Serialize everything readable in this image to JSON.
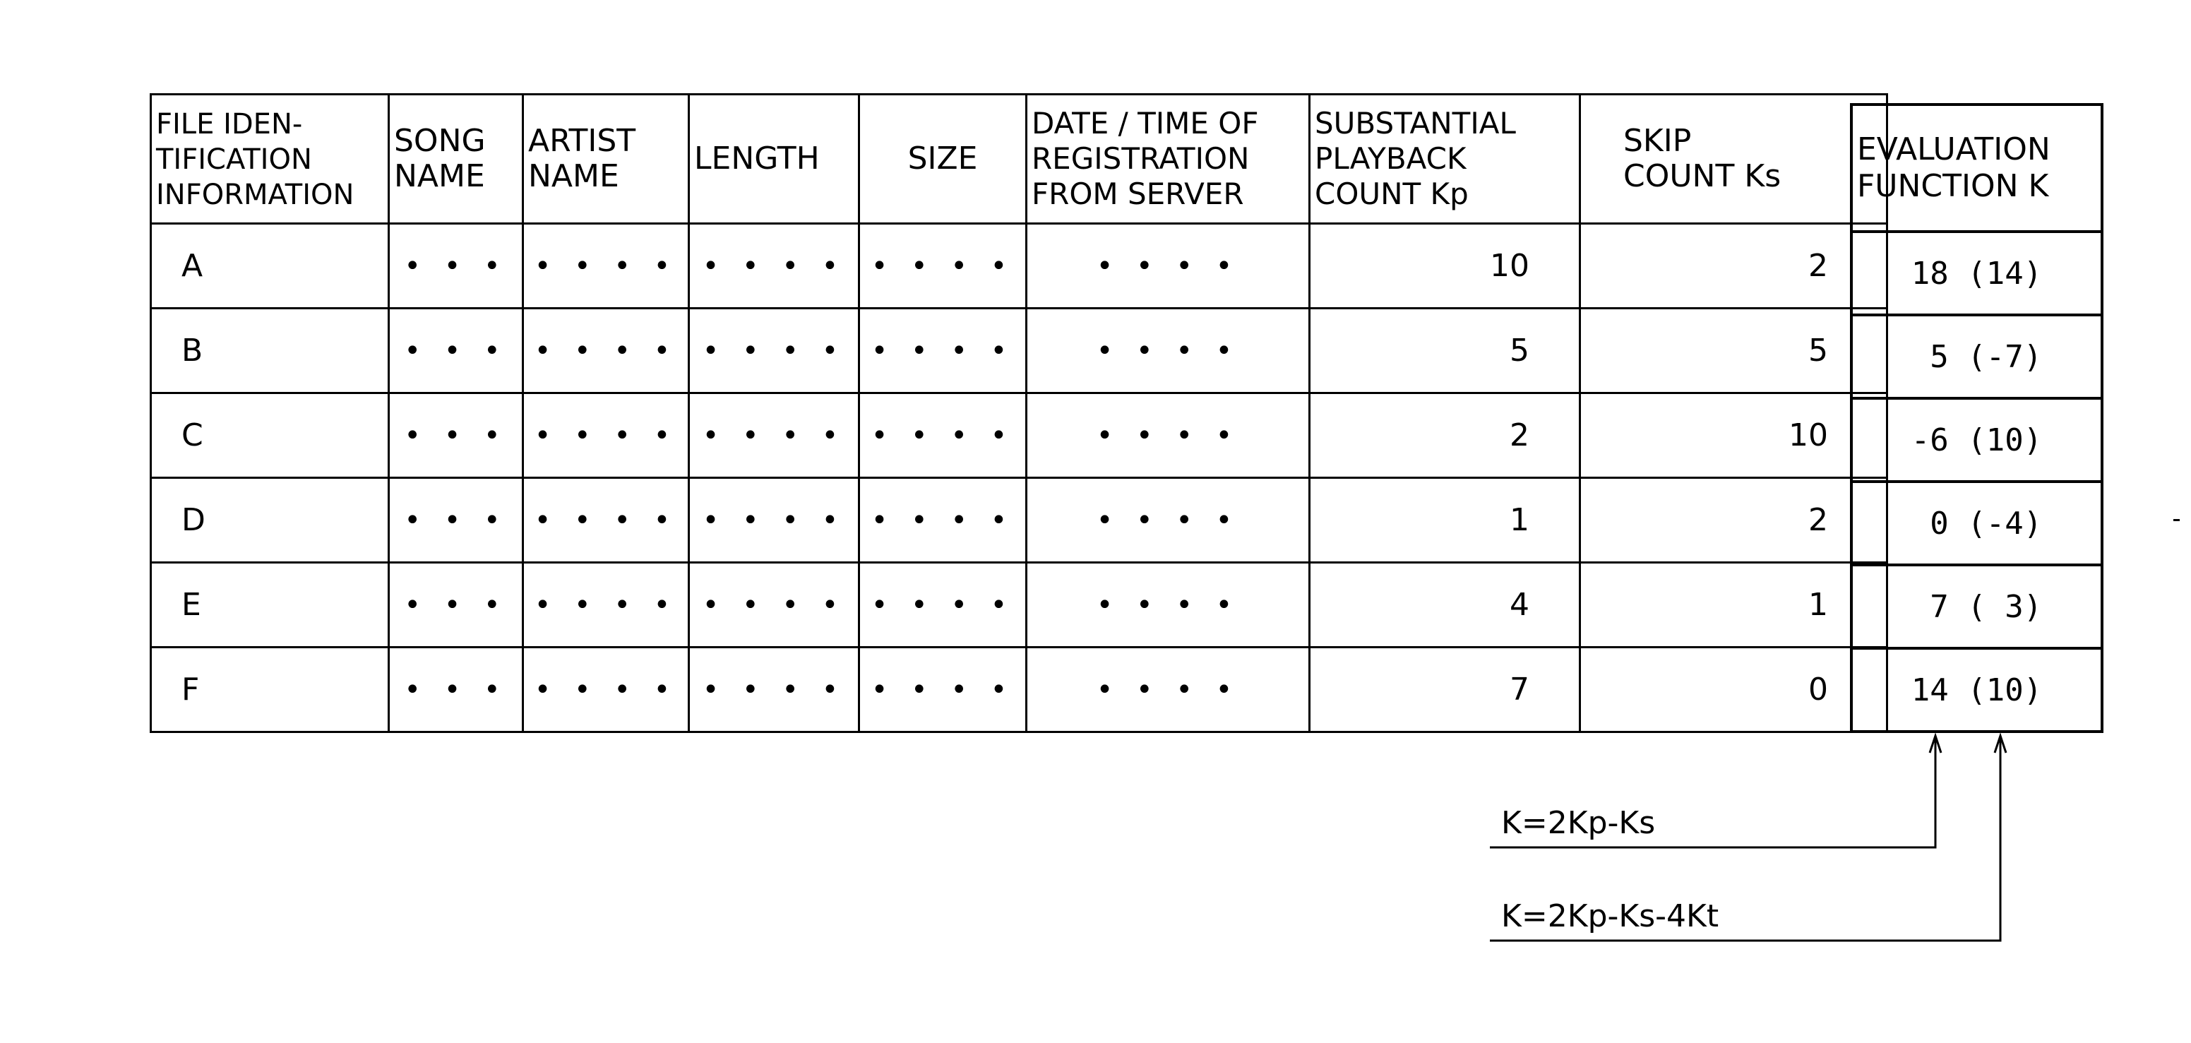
{
  "table": {
    "headers": [
      "FILE IDEN-\nTIFICATION\nINFORMATION",
      "SONG\nNAME",
      "ARTIST\nNAME",
      "LENGTH",
      "SIZE",
      "DATE / TIME OF\nREGISTRATION\nFROM SERVER",
      "SUBSTANTIAL\nPLAYBACK\nCOUNT Kp",
      "SKIP\nCOUNT Ks"
    ],
    "rows": [
      {
        "id": "A",
        "song": "• • •",
        "artist": "• • • •",
        "length": "• • • •",
        "size": "• • • •",
        "date": "• • • •",
        "kp": "10",
        "ks": "2"
      },
      {
        "id": "B",
        "song": "• • •",
        "artist": "• • • •",
        "length": "• • • •",
        "size": "• • • •",
        "date": "• • • •",
        "kp": "5",
        "ks": "5"
      },
      {
        "id": "C",
        "song": "• • •",
        "artist": "• • • •",
        "length": "• • • •",
        "size": "• • • •",
        "date": "• • • •",
        "kp": "2",
        "ks": "10"
      },
      {
        "id": "D",
        "song": "• • •",
        "artist": "• • • •",
        "length": "• • • •",
        "size": "• • • •",
        "date": "• • • •",
        "kp": "1",
        "ks": "2"
      },
      {
        "id": "E",
        "song": "• • •",
        "artist": "• • • •",
        "length": "• • • •",
        "size": "• • • •",
        "date": "• • • •",
        "kp": "4",
        "ks": "1"
      },
      {
        "id": "F",
        "song": "• • •",
        "artist": "• • • •",
        "length": "• • • •",
        "size": "• • • •",
        "date": "• • • •",
        "kp": "7",
        "ks": "0"
      }
    ]
  },
  "evaluation": {
    "header": "EVALUATION\nFUNCTION K",
    "values": [
      "18 (14)",
      " 5 (-7)",
      "-6 (10)",
      " 0 (-4)",
      " 7 ( 3)",
      "14 (10)"
    ]
  },
  "formulas": {
    "formula_1": "K=2Kp-Ks",
    "formula_2": "K=2Kp-Ks-4Kt"
  }
}
